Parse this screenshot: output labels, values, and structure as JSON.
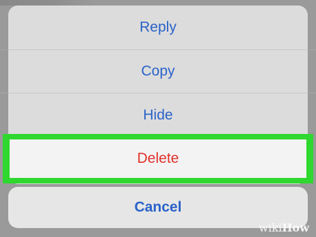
{
  "action_sheet": {
    "actions": [
      {
        "label": "Reply"
      },
      {
        "label": "Copy"
      },
      {
        "label": "Hide"
      },
      {
        "label": "Delete"
      }
    ],
    "cancel_label": "Cancel"
  },
  "watermark": {
    "prefix": "wiki",
    "suffix": "How"
  },
  "colors": {
    "action_blue": "#2a62c9",
    "destructive_red": "#e0302b",
    "highlight_green": "#2ed82e"
  }
}
